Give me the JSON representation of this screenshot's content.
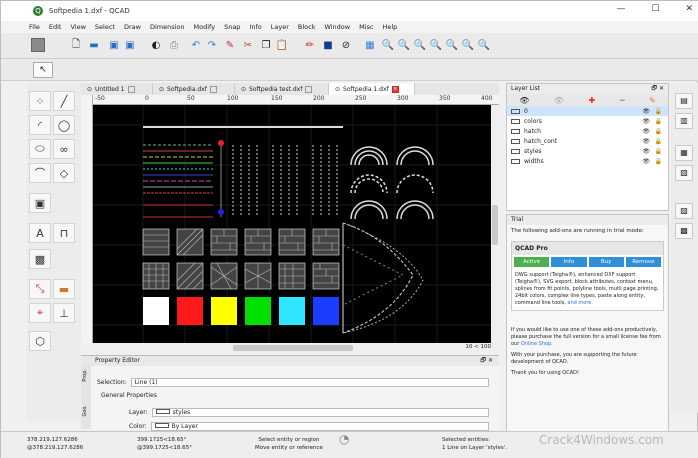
{
  "window": {
    "title": "Softpedia 1.dxf - QCAD",
    "controls": [
      "—",
      "☐",
      "✕"
    ]
  },
  "menu": [
    "File",
    "Edit",
    "View",
    "Select",
    "Draw",
    "Dimension",
    "Modify",
    "Snap",
    "Info",
    "Layer",
    "Block",
    "Window",
    "Misc",
    "Help"
  ],
  "tabs": [
    {
      "label": "Untitled 1",
      "active": false
    },
    {
      "label": "Softpedia.dxf",
      "active": false
    },
    {
      "label": "Softpedia test.dxf",
      "active": false
    },
    {
      "label": "Softpedia 1.dxf",
      "active": true
    }
  ],
  "ruler_top": [
    "-50",
    "0",
    "50",
    "100",
    "150",
    "200",
    "250",
    "300",
    "350",
    "400"
  ],
  "canvas_status": "10 < 100",
  "property_editor": {
    "title": "Property Editor",
    "selection_label": "Selection:",
    "selection_value": "Line (1)",
    "section": "General Properties",
    "layer_label": "Layer:",
    "layer_value": "styles",
    "color_label": "Color:",
    "color_value": "By Layer",
    "side_tabs": [
      "Prop.",
      "Geo."
    ]
  },
  "layer_list": {
    "title": "Layer List",
    "layers": [
      "0",
      "colors",
      "hatch",
      "hatch_cont",
      "styles",
      "widths"
    ]
  },
  "trial": {
    "title": "Trial",
    "intro": "The following add-ons are running in trial mode:",
    "qcad_pro": "QCAD Pro",
    "buttons": [
      "Active",
      "Info",
      "Buy",
      "Remove"
    ],
    "description": "DWG support (Teigha®), enhanced DXF support (Teigha®), SVG export, block attributes, context menu, splines from fit points, polyline tools, multi page printing, 24bit colors, complex line types, paste along entity, command line tools,",
    "and_more": "and more.",
    "purchase": "If you would like to use one of these add-ons productively, please purchase the full version for a small license fee from our",
    "shop": "Online Shop.",
    "support": "With your purchase, you are supporting the future development of QCAD.",
    "thanks": "Thank you for using QCAD!"
  },
  "status": {
    "coord_abs": "378.219,127.6286",
    "coord_rel": "@378.219,127.6286",
    "polar_abs": "399.1725<18.65°",
    "polar_rel": "@399.1725<18.65°",
    "hint1": "Select entity or region",
    "hint2": "Move entity or reference",
    "sel_label": "Selected entities:",
    "sel_value": "1 Line on Layer 'styles'."
  },
  "watermark": "Crack4Windows.com",
  "colors": {
    "swatches": [
      "#ffffff",
      "#ff1a1a",
      "#ffff00",
      "#00e000",
      "#2ee6ff",
      "#1a3dff"
    ]
  }
}
